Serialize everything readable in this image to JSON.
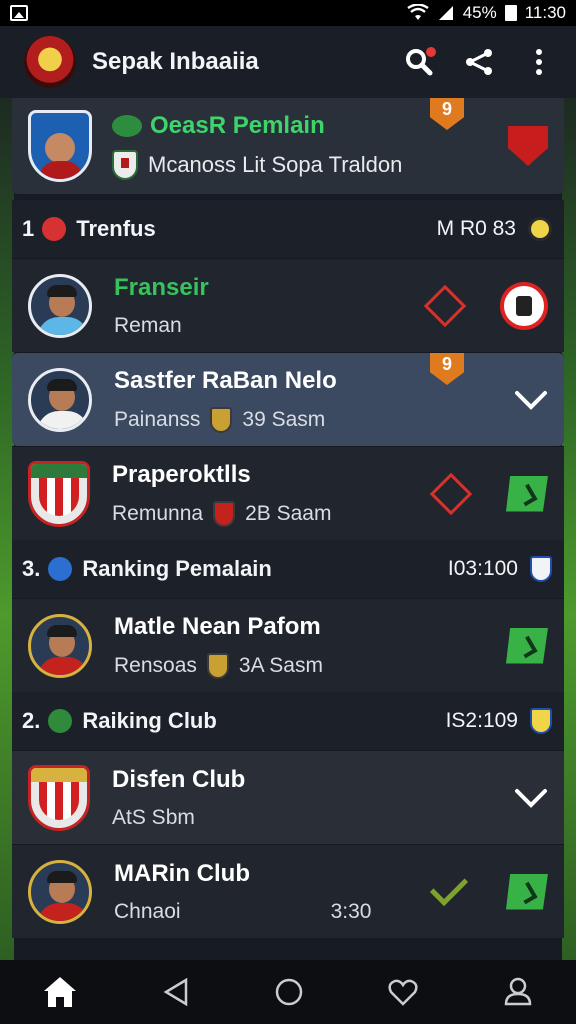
{
  "statusbar": {
    "battery": "45%",
    "time": "11:30"
  },
  "app": {
    "title": "Sepak Inbaaiia"
  },
  "featured": {
    "line1": "OeasR Pemlain",
    "line2": "Mcanoss Lit Sopa Traldon",
    "rank": "9"
  },
  "sections": [
    {
      "num": "1",
      "label": "Trenfus",
      "value": "M R0 83"
    },
    {
      "num": "3.",
      "label": "Ranking Pemalain",
      "value": "I03:100"
    },
    {
      "num": "2.",
      "label": "Raiking Club",
      "value": "IS2:109"
    }
  ],
  "rows": [
    {
      "name": "Franseir",
      "sub": "Reman"
    },
    {
      "name": "Sastfer RaBan Nelo",
      "sub": "Painanss",
      "score": "39 Sasm",
      "rank": "9"
    },
    {
      "name": "Praperoktlls",
      "sub": "Remunna",
      "score": "2B Saam"
    },
    {
      "name": "Matle Nean Pafom",
      "sub": "Rensoas",
      "score": "3A Sasm"
    },
    {
      "name": "Disfen Club",
      "sub": "AtS Sbm"
    },
    {
      "name": "MARin Club",
      "sub": "Chnaoi",
      "time": "3:30"
    }
  ],
  "colors": {
    "accent_green": "#37c25e",
    "selected_row": "#3b4961",
    "flag_orange": "#e07a1f",
    "alert_red": "#d9302a"
  }
}
